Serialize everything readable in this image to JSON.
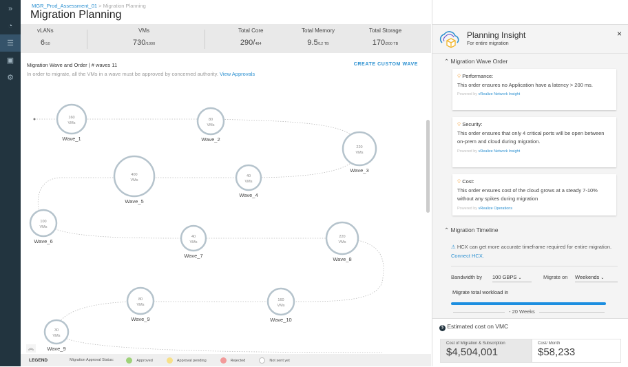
{
  "nav": {
    "items": [
      "expand-icon",
      "dashboard-icon",
      "list-icon",
      "report-icon",
      "settings-icon"
    ],
    "active": 2
  },
  "breadcrumb": {
    "link": "MGR_Prod_Assessment_01",
    "separator": ">",
    "current": "Migration Planning"
  },
  "page_title": "Migration Planning",
  "stats": [
    {
      "label": "vLANs",
      "value": "6",
      "total": "/10"
    },
    {
      "label": "VMs",
      "value": "730",
      "total": "/1000"
    },
    {
      "label": "Total Core",
      "value": "290/",
      "total": "484"
    },
    {
      "label": "Total Memory",
      "value": "9.5",
      "total": "/12 TB"
    },
    {
      "label": "Total Storage",
      "value": "170",
      "total": "/200 TB"
    }
  ],
  "waves_section": {
    "title": "Migration Wave and Order | # waves 11",
    "create_button": "CREATE CUSTOM WAVE",
    "note": "In order to migrate, all the VMs in a wave must be approved by concerned authority.",
    "note_link": "View Approvals",
    "vm_unit": "VMs",
    "waves": [
      {
        "name": "Wave_1",
        "vms": "160"
      },
      {
        "name": "Wave_2",
        "vms": "80"
      },
      {
        "name": "Wave_3",
        "vms": "220"
      },
      {
        "name": "Wave_4",
        "vms": "40"
      },
      {
        "name": "Wave_5",
        "vms": "400"
      },
      {
        "name": "Wave_6",
        "vms": "100"
      },
      {
        "name": "Wave_7",
        "vms": "40"
      },
      {
        "name": "Wave_8",
        "vms": "220"
      },
      {
        "name": "Wave_9",
        "vms": "80"
      },
      {
        "name": "Wave_10",
        "vms": "160"
      },
      {
        "name": "Wave_9",
        "vms": "30"
      }
    ]
  },
  "legend": {
    "title": "LEGEND",
    "status_label": "Migration Approval Status:",
    "items": [
      {
        "label": "Approved",
        "color": "#9fd27a"
      },
      {
        "label": "Approval pending",
        "color": "#f7e08a"
      },
      {
        "label": "Rejected",
        "color": "#f29a9a"
      },
      {
        "label": "Not sent yet",
        "color": "#ffffff"
      }
    ]
  },
  "insight": {
    "title": "Planning Insight",
    "subtitle": "For entire migration",
    "close": "×",
    "wave_order_title": "Migration Wave Order",
    "powered_by": "Powered by",
    "cards": [
      {
        "heading": "Performance:",
        "text": "This order ensures no Application have a latency > 200 ms.",
        "source": "vRealize Network Insight"
      },
      {
        "heading": "Security:",
        "text": "This order ensures that only 4 critical ports will be open between on-prem and cloud during migration.",
        "source": "vRealize Network Insight"
      },
      {
        "heading": "Cost:",
        "text": "This order ensures cost of the cloud grows at a steady 7-10% without any spikes during migration",
        "source": "vRealize Operations"
      }
    ],
    "timeline_title": "Migration Timeline",
    "hcx_note": "HCX can get more accurate timeframe required for entire migration.",
    "hcx_link": "Connect HCX.",
    "bandwidth_label": "Bandwidth by",
    "bandwidth_value": "100 GBPS",
    "migrate_on_label": "Migrate on",
    "migrate_on_value": "Weekends",
    "workload_label": "Migrate total workload in",
    "workload_progress": 1.0,
    "duration": "- 20 Weeks",
    "cost_title": "Estimated cost on VMC",
    "cost_migration_label": "Cost of Migration & Subscription",
    "cost_migration_value": "$4,504,001",
    "cost_month_label": "Cost/ Month",
    "cost_month_value": "$58,233"
  }
}
